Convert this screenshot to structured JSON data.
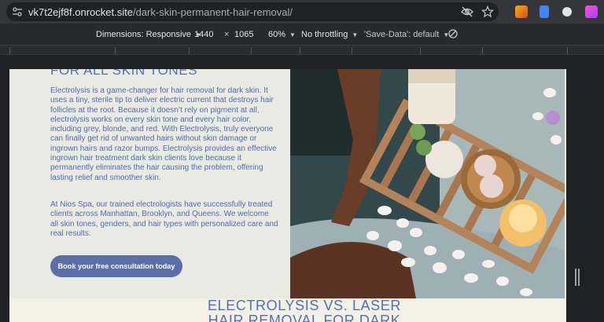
{
  "browser": {
    "url_domain": "vk7t2ejf8f.onrocket.site",
    "url_path": "/dark-skin-permanent-hair-removal/",
    "icons": [
      "site-info-icon",
      "eye-off-icon",
      "star-icon"
    ]
  },
  "devtools": {
    "dimensions_label": "Dimensions: Responsive",
    "width": "1440",
    "times": "×",
    "height": "1065",
    "zoom": "60%",
    "throttling": "No throttling",
    "save_data": "'Save-Data': default",
    "rotate_icon": "rotate-icon"
  },
  "page": {
    "heading_top": "FOR ALL SKIN TONES",
    "paragraph_1": "Electrolysis is a game-changer for hair removal for dark skin. It uses a tiny, sterile tip to deliver electric current that destroys hair follicles at the root. Because it doesn’t rely on pigment at all, electrolysis works on every skin tone and every hair color, including grey, blonde, and red. With Electrolysis, truly everyone can finally get rid of unwanted hairs without skin damage or ingrown hairs and razor bumps. Electrolysis provides an effective ingrown hair treatment dark skin clients love because it permanently eliminates the hair causing the problem, offering lasting relief and smoother skin.",
    "paragraph_2": "At Nios Spa, our trained electrologists have successfully treated clients across Manhattan, Brooklyn, and Queens. We welcome all skin tones, genders, and hair types with personalized care and real results.",
    "cta_label": "Book your free consultation today",
    "heading_bottom": "ELECTROLYSIS VS. LASER HAIR REMOVAL FOR DARK"
  },
  "colors": {
    "brand_blue": "#5470b5",
    "button_bg": "#5a6fa8",
    "panel_bg": "#e9ebe3",
    "page_bg": "#f3f1e6"
  }
}
